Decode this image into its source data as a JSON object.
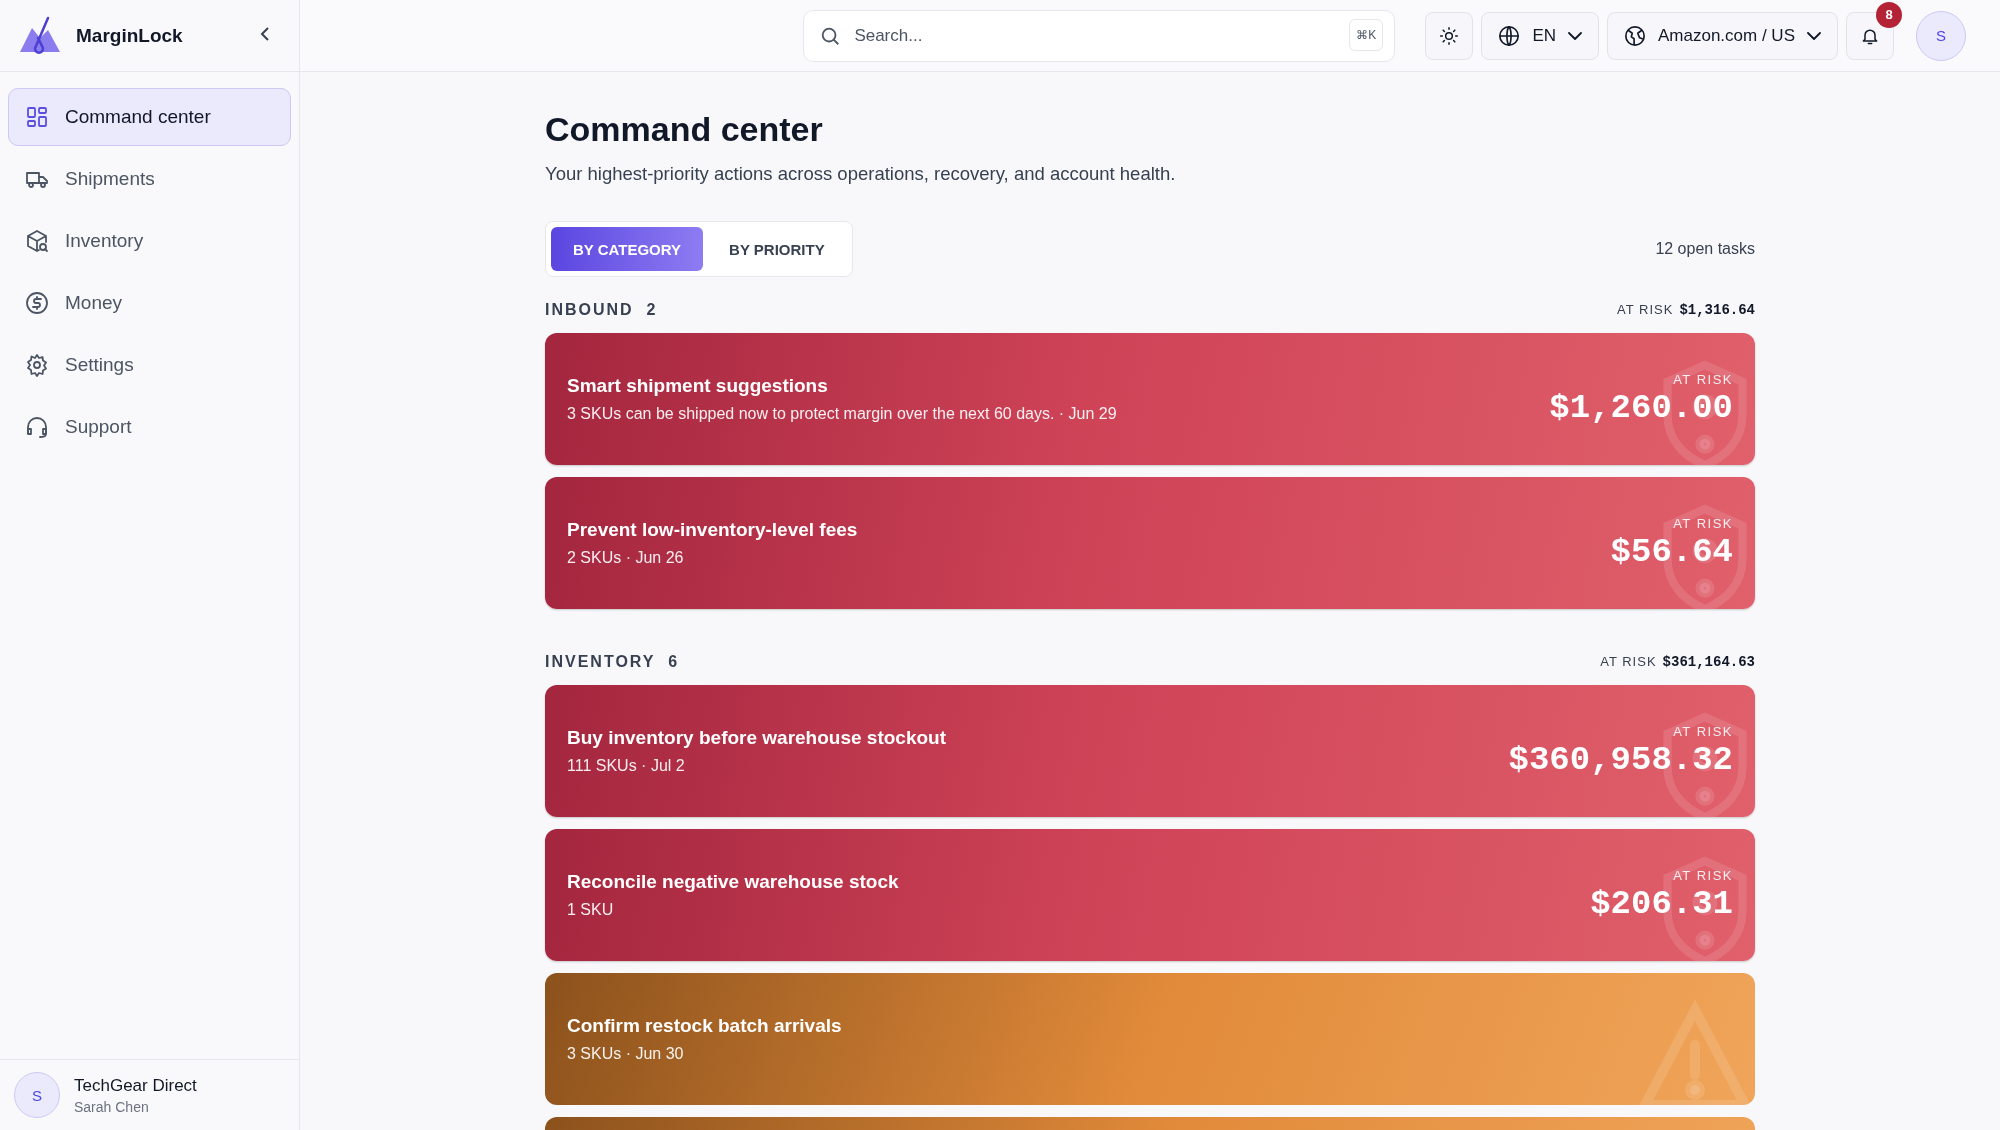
{
  "app": {
    "name": "MarginLock"
  },
  "sidebar": {
    "items": [
      {
        "label": "Command center",
        "selected": true
      },
      {
        "label": "Shipments",
        "selected": false
      },
      {
        "label": "Inventory",
        "selected": false
      },
      {
        "label": "Money",
        "selected": false
      },
      {
        "label": "Settings",
        "selected": false
      },
      {
        "label": "Support",
        "selected": false
      }
    ],
    "account": {
      "avatar": "S",
      "name": "TechGear Direct",
      "user": "Sarah Chen"
    }
  },
  "topbar": {
    "search": {
      "placeholder": "Search...",
      "shortcut": "⌘K"
    },
    "language": "EN",
    "marketplace": "Amazon.com / US",
    "notifications": "8",
    "avatar": "S"
  },
  "page": {
    "title": "Command center",
    "subtitle": "Your highest-priority actions across operations, recovery, and account health.",
    "tabs": [
      {
        "label": "BY CATEGORY",
        "selected": true
      },
      {
        "label": "BY PRIORITY",
        "selected": false
      }
    ],
    "open_tasks": "12 open tasks"
  },
  "sections": [
    {
      "name": "INBOUND",
      "count": "2",
      "at_risk_label": "AT RISK",
      "at_risk": "$1,316.64",
      "tasks": [
        {
          "kind": "risk",
          "title": "Smart shipment suggestions",
          "detail": "3 SKUs can be shipped now to protect margin over the next 60 days. · Jun 29",
          "label": "AT RISK",
          "amount": "$1,260.00"
        },
        {
          "kind": "risk",
          "title": "Prevent low-inventory-level fees",
          "detail": "2 SKUs · Jun 26",
          "label": "AT RISK",
          "amount": "$56.64"
        }
      ]
    },
    {
      "name": "INVENTORY",
      "count": "6",
      "at_risk_label": "AT RISK",
      "at_risk": "$361,164.63",
      "tasks": [
        {
          "kind": "risk",
          "title": "Buy inventory before warehouse stockout",
          "detail": "111 SKUs · Jul 2",
          "label": "AT RISK",
          "amount": "$360,958.32"
        },
        {
          "kind": "risk",
          "title": "Reconcile negative warehouse stock",
          "detail": "1 SKU",
          "label": "AT RISK",
          "amount": "$206.31"
        },
        {
          "kind": "warning",
          "title": "Confirm restock batch arrivals",
          "detail": "3 SKUs · Jun 30"
        },
        {
          "kind": "warning"
        }
      ]
    }
  ]
}
